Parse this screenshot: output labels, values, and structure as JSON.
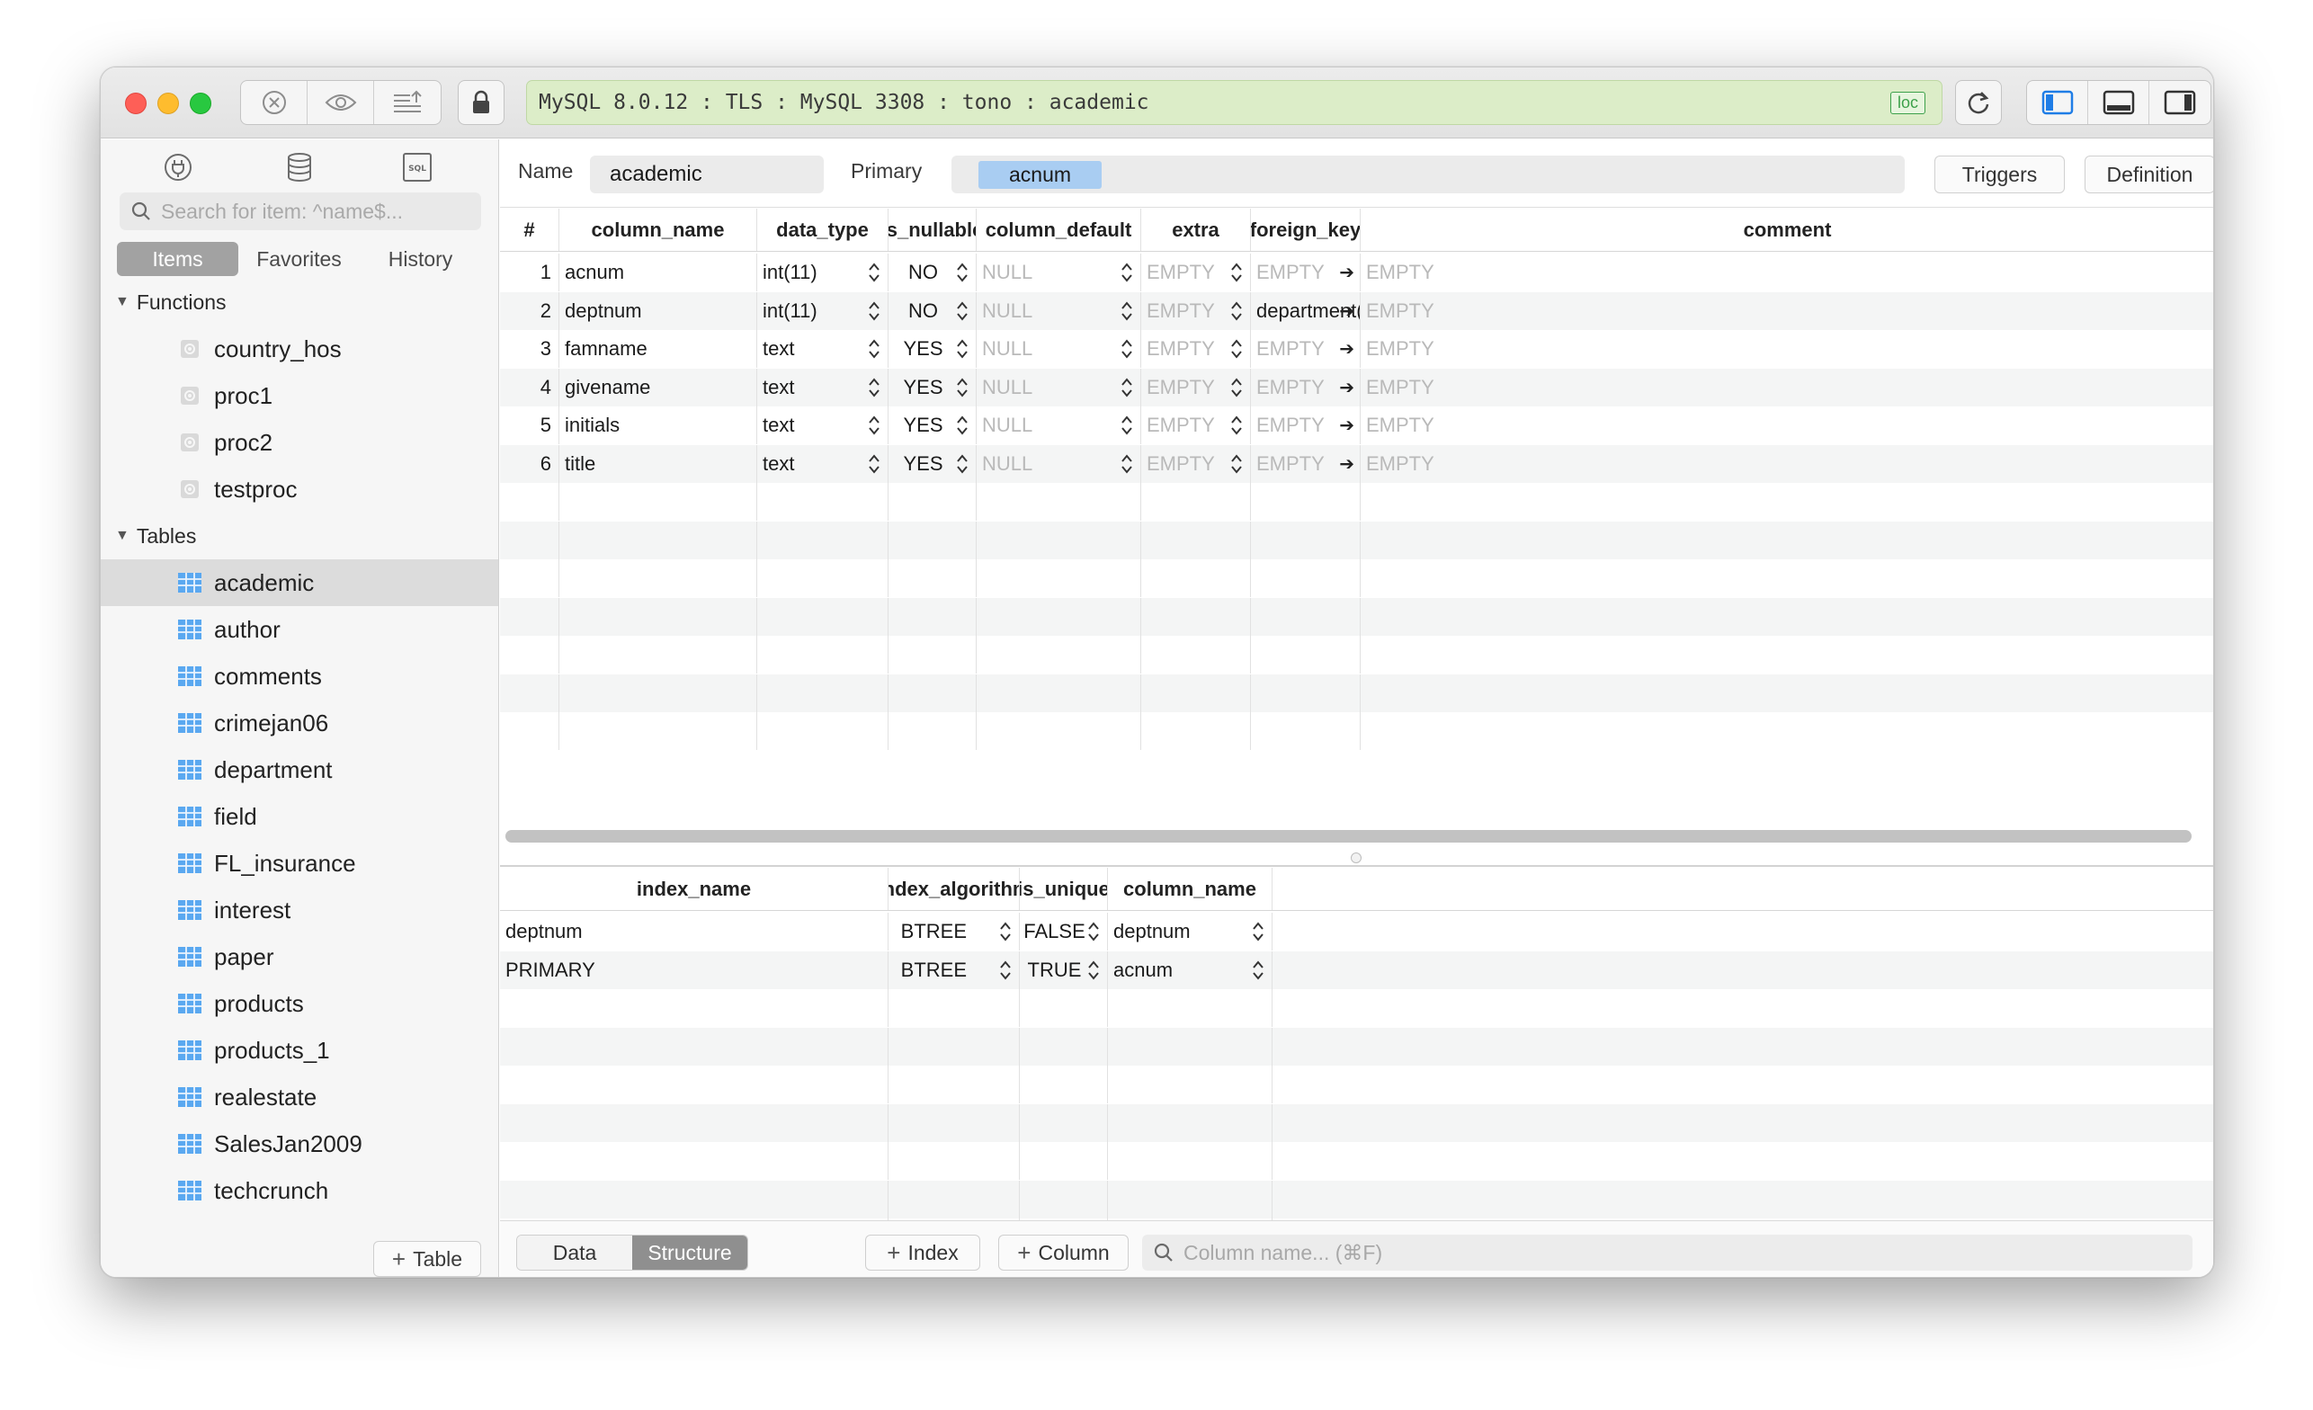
{
  "connection": {
    "text": "MySQL 8.0.12 : TLS : MySQL 3308 : tono : academic",
    "badge": "loc",
    "color": "#dcedc8"
  },
  "toolbar": {
    "icons": [
      "close-circle-icon",
      "eye-icon",
      "list-upload-icon",
      "lock-icon",
      "refresh-icon",
      "sidebar-left-icon",
      "panel-bottom-icon",
      "sidebar-right-icon"
    ]
  },
  "sidebar": {
    "search_placeholder": "Search for item: ^name$...",
    "tabs": [
      "Items",
      "Favorites",
      "History"
    ],
    "active_tab": "Items",
    "functions_label": "Functions",
    "functions": [
      "country_hos",
      "proc1",
      "proc2",
      "testproc"
    ],
    "tables_label": "Tables",
    "tables": [
      "academic",
      "author",
      "comments",
      "crimejan06",
      "department",
      "field",
      "FL_insurance",
      "interest",
      "paper",
      "products",
      "products_1",
      "realestate",
      "SalesJan2009",
      "techcrunch"
    ],
    "selected_table": "academic",
    "add_table_label": "Table"
  },
  "props": {
    "name_label": "Name",
    "name_value": "academic",
    "primary_label": "Primary",
    "primary_value": "acnum",
    "triggers_label": "Triggers",
    "definition_label": "Definition"
  },
  "columns_table": {
    "headers": [
      "#",
      "column_name",
      "data_type",
      "is_nullable",
      "column_default",
      "extra",
      "foreign_key",
      "comment"
    ],
    "rows": [
      {
        "n": "1",
        "name": "acnum",
        "type": "int(11)",
        "nullable": "NO",
        "default": "NULL",
        "extra": "EMPTY",
        "fk": "EMPTY",
        "comment": "EMPTY"
      },
      {
        "n": "2",
        "name": "deptnum",
        "type": "int(11)",
        "nullable": "NO",
        "default": "NULL",
        "extra": "EMPTY",
        "fk": "department(d...",
        "comment": "EMPTY"
      },
      {
        "n": "3",
        "name": "famname",
        "type": "text",
        "nullable": "YES",
        "default": "NULL",
        "extra": "EMPTY",
        "fk": "EMPTY",
        "comment": "EMPTY"
      },
      {
        "n": "4",
        "name": "givename",
        "type": "text",
        "nullable": "YES",
        "default": "NULL",
        "extra": "EMPTY",
        "fk": "EMPTY",
        "comment": "EMPTY"
      },
      {
        "n": "5",
        "name": "initials",
        "type": "text",
        "nullable": "YES",
        "default": "NULL",
        "extra": "EMPTY",
        "fk": "EMPTY",
        "comment": "EMPTY"
      },
      {
        "n": "6",
        "name": "title",
        "type": "text",
        "nullable": "YES",
        "default": "NULL",
        "extra": "EMPTY",
        "fk": "EMPTY",
        "comment": "EMPTY"
      }
    ]
  },
  "index_table": {
    "headers": [
      "index_name",
      "index_algorithm",
      "is_unique",
      "column_name"
    ],
    "rows": [
      {
        "name": "deptnum",
        "algo": "BTREE",
        "unique": "FALSE",
        "column": "deptnum"
      },
      {
        "name": "PRIMARY",
        "algo": "BTREE",
        "unique": "TRUE",
        "column": "acnum"
      }
    ]
  },
  "bottom": {
    "tabs": [
      "Data",
      "Structure"
    ],
    "active_tab": "Structure",
    "add_index_label": "Index",
    "add_column_label": "Column",
    "search_placeholder": "Column name... (⌘F)"
  }
}
